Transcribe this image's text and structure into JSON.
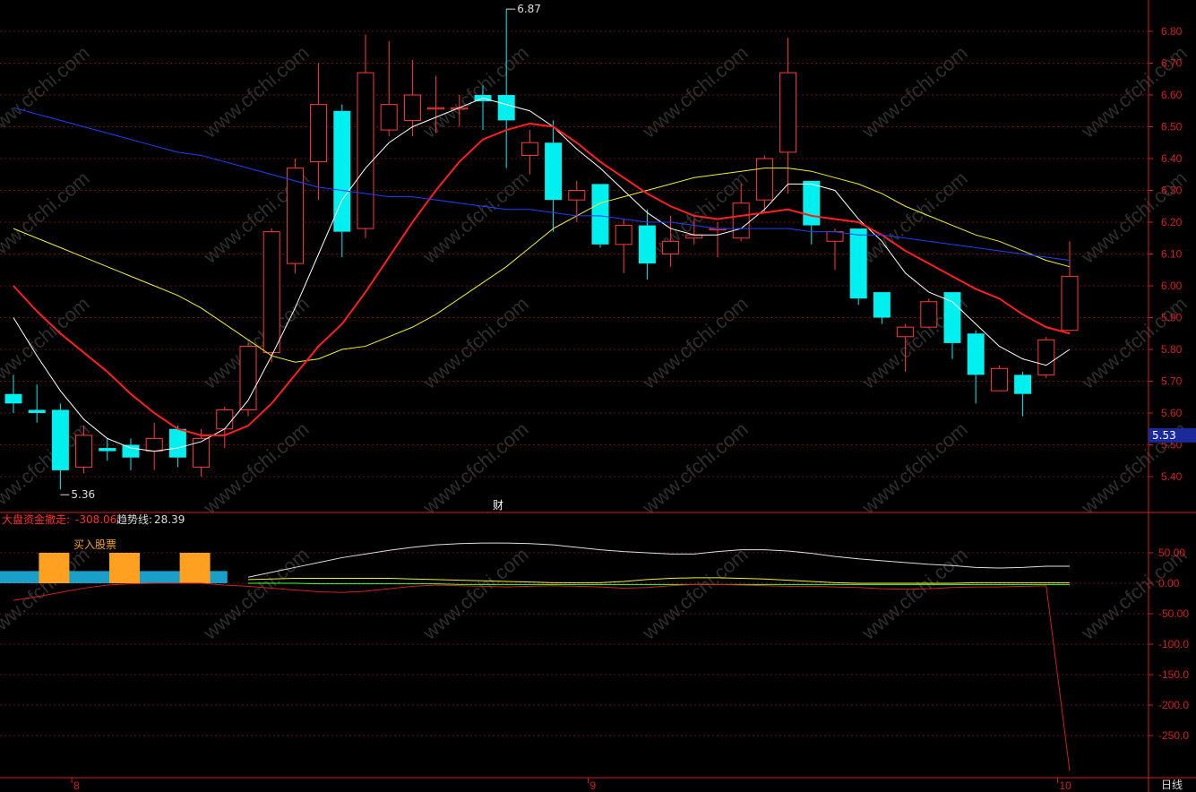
{
  "chart_data": [
    {
      "type": "candlestick",
      "panel": "price",
      "ylim": [
        5.35,
        6.9
      ],
      "yticks": [
        "6.80",
        "6.70",
        "6.60",
        "6.50",
        "6.40",
        "6.30",
        "6.20",
        "6.10",
        "6.00",
        "5.90",
        "5.80",
        "5.70",
        "5.60",
        "5.50",
        "5.40"
      ],
      "current_price_label": "5.53",
      "high_marker": "6.87",
      "low_marker": "5.36",
      "event_marker": "财",
      "candles": [
        {
          "o": 5.66,
          "c": 5.63,
          "h": 5.72,
          "l": 5.6
        },
        {
          "o": 5.61,
          "c": 5.6,
          "h": 5.69,
          "l": 5.57
        },
        {
          "o": 5.61,
          "c": 5.42,
          "h": 5.63,
          "l": 5.36
        },
        {
          "o": 5.43,
          "c": 5.53,
          "h": 5.56,
          "l": 5.41
        },
        {
          "o": 5.49,
          "c": 5.48,
          "h": 5.52,
          "l": 5.45
        },
        {
          "o": 5.5,
          "c": 5.46,
          "h": 5.52,
          "l": 5.42
        },
        {
          "o": 5.48,
          "c": 5.52,
          "h": 5.57,
          "l": 5.42
        },
        {
          "o": 5.55,
          "c": 5.46,
          "h": 5.56,
          "l": 5.43
        },
        {
          "o": 5.43,
          "c": 5.52,
          "h": 5.55,
          "l": 5.4
        },
        {
          "o": 5.55,
          "c": 5.61,
          "h": 5.62,
          "l": 5.49
        },
        {
          "o": 5.61,
          "c": 5.81,
          "h": 5.82,
          "l": 5.59
        },
        {
          "o": 5.79,
          "c": 6.17,
          "h": 6.18,
          "l": 5.76
        },
        {
          "o": 6.07,
          "c": 6.37,
          "h": 6.4,
          "l": 6.04
        },
        {
          "o": 6.39,
          "c": 6.57,
          "h": 6.7,
          "l": 6.27
        },
        {
          "o": 6.55,
          "c": 6.17,
          "h": 6.57,
          "l": 6.09
        },
        {
          "o": 6.18,
          "c": 6.67,
          "h": 6.79,
          "l": 6.15
        },
        {
          "o": 6.49,
          "c": 6.57,
          "h": 6.77,
          "l": 6.47
        },
        {
          "o": 6.52,
          "c": 6.6,
          "h": 6.71,
          "l": 6.47
        },
        {
          "o": 6.56,
          "c": 6.56,
          "h": 6.66,
          "l": 6.48
        },
        {
          "o": 6.56,
          "c": 6.56,
          "h": 6.6,
          "l": 6.5
        },
        {
          "o": 6.6,
          "c": 6.58,
          "h": 6.63,
          "l": 6.49
        },
        {
          "o": 6.6,
          "c": 6.52,
          "h": 6.87,
          "l": 6.37
        },
        {
          "o": 6.41,
          "c": 6.45,
          "h": 6.49,
          "l": 6.35
        },
        {
          "o": 6.45,
          "c": 6.27,
          "h": 6.52,
          "l": 6.17
        },
        {
          "o": 6.27,
          "c": 6.3,
          "h": 6.33,
          "l": 6.2
        },
        {
          "o": 6.32,
          "c": 6.13,
          "h": 6.32,
          "l": 6.12
        },
        {
          "o": 6.13,
          "c": 6.19,
          "h": 6.21,
          "l": 6.04
        },
        {
          "o": 6.19,
          "c": 6.07,
          "h": 6.24,
          "l": 6.02
        },
        {
          "o": 6.1,
          "c": 6.14,
          "h": 6.22,
          "l": 6.06
        },
        {
          "o": 6.15,
          "c": 6.16,
          "h": 6.21,
          "l": 6.13
        },
        {
          "o": 6.18,
          "c": 6.18,
          "h": 6.2,
          "l": 6.09
        },
        {
          "o": 6.15,
          "c": 6.26,
          "h": 6.32,
          "l": 6.14
        },
        {
          "o": 6.27,
          "c": 6.4,
          "h": 6.41,
          "l": 6.23
        },
        {
          "o": 6.42,
          "c": 6.67,
          "h": 6.78,
          "l": 6.29
        },
        {
          "o": 6.33,
          "c": 6.19,
          "h": 6.33,
          "l": 6.13
        },
        {
          "o": 6.14,
          "c": 6.17,
          "h": 6.18,
          "l": 6.05
        },
        {
          "o": 6.18,
          "c": 5.96,
          "h": 6.18,
          "l": 5.94
        },
        {
          "o": 5.98,
          "c": 5.9,
          "h": 5.98,
          "l": 5.88
        },
        {
          "o": 5.84,
          "c": 5.87,
          "h": 5.88,
          "l": 5.73
        },
        {
          "o": 5.87,
          "c": 5.95,
          "h": 5.96,
          "l": 5.87
        },
        {
          "o": 5.98,
          "c": 5.82,
          "h": 5.98,
          "l": 5.77
        },
        {
          "o": 5.85,
          "c": 5.72,
          "h": 5.86,
          "l": 5.63
        },
        {
          "o": 5.67,
          "c": 5.74,
          "h": 5.75,
          "l": 5.67
        },
        {
          "o": 5.72,
          "c": 5.66,
          "h": 5.73,
          "l": 5.59
        },
        {
          "o": 5.72,
          "c": 5.83,
          "h": 5.84,
          "l": 5.71
        },
        {
          "o": 5.86,
          "c": 6.03,
          "h": 6.14,
          "l": 5.86
        }
      ],
      "moving_averages": [
        {
          "color": "#ffffff",
          "values": [
            5.9,
            5.78,
            5.67,
            5.58,
            5.52,
            5.49,
            5.48,
            5.49,
            5.51,
            5.55,
            5.64,
            5.78,
            5.93,
            6.1,
            6.27,
            6.37,
            6.45,
            6.5,
            6.53,
            6.56,
            6.59,
            6.57,
            6.55,
            6.5,
            6.43,
            6.37,
            6.3,
            6.23,
            6.18,
            6.16,
            6.16,
            6.18,
            6.24,
            6.32,
            6.32,
            6.3,
            6.21,
            6.14,
            6.04,
            5.98,
            5.95,
            5.88,
            5.81,
            5.77,
            5.75,
            5.8
          ]
        },
        {
          "color": "#f0f030",
          "values": [
            6.18,
            6.15,
            6.12,
            6.09,
            6.06,
            6.03,
            6.0,
            5.97,
            5.93,
            5.88,
            5.83,
            5.78,
            5.76,
            5.77,
            5.8,
            5.81,
            5.84,
            5.87,
            5.91,
            5.96,
            6.01,
            6.06,
            6.12,
            6.18,
            6.22,
            6.26,
            6.28,
            6.3,
            6.32,
            6.34,
            6.35,
            6.36,
            6.37,
            6.37,
            6.36,
            6.34,
            6.32,
            6.29,
            6.25,
            6.22,
            6.19,
            6.16,
            6.14,
            6.11,
            6.08,
            6.06
          ]
        },
        {
          "color": "#ff2020",
          "values": [
            6.0,
            5.92,
            5.85,
            5.79,
            5.73,
            5.66,
            5.6,
            5.55,
            5.53,
            5.53,
            5.56,
            5.63,
            5.72,
            5.81,
            5.88,
            5.98,
            6.09,
            6.2,
            6.3,
            6.39,
            6.46,
            6.49,
            6.51,
            6.5,
            6.45,
            6.39,
            6.34,
            6.29,
            6.25,
            6.22,
            6.21,
            6.22,
            6.23,
            6.24,
            6.22,
            6.21,
            6.2,
            6.16,
            6.11,
            6.07,
            6.03,
            5.99,
            5.96,
            5.91,
            5.87,
            5.85
          ]
        },
        {
          "color": "#2040ff",
          "values": [
            6.56,
            6.54,
            6.52,
            6.5,
            6.48,
            6.46,
            6.44,
            6.42,
            6.41,
            6.39,
            6.37,
            6.35,
            6.33,
            6.31,
            6.3,
            6.29,
            6.28,
            6.28,
            6.27,
            6.26,
            6.25,
            6.24,
            6.24,
            6.23,
            6.22,
            6.22,
            6.21,
            6.2,
            6.2,
            6.19,
            6.18,
            6.18,
            6.18,
            6.18,
            6.17,
            6.17,
            6.16,
            6.16,
            6.15,
            6.14,
            6.13,
            6.12,
            6.11,
            6.1,
            6.09,
            6.08
          ]
        }
      ]
    },
    {
      "type": "line",
      "panel": "indicator",
      "ylim": [
        -310,
        100
      ],
      "yticks": [
        "50.00",
        "0.00",
        "-50.00",
        "-100.0",
        "-150.0",
        "-200.0",
        "-250.0"
      ],
      "legend": [
        {
          "label": "大盘资金撤走:",
          "value": "-308.06",
          "color": "#ff3030"
        },
        {
          "label": "趋势线:",
          "value": "28.39",
          "color": "#dddddd"
        }
      ],
      "buy_label": "买入股票",
      "buy_bars": [
        2,
        5,
        8
      ],
      "blue_band": [
        0,
        9
      ],
      "series": [
        {
          "color": "#dddddd",
          "values": [
            null,
            null,
            null,
            null,
            null,
            null,
            null,
            null,
            null,
            null,
            10,
            18,
            26,
            34,
            42,
            48,
            54,
            59,
            63,
            65,
            66,
            66,
            65,
            63,
            59,
            55,
            52,
            50,
            48,
            48,
            52,
            55,
            55,
            53,
            49,
            44,
            40,
            37,
            34,
            31,
            29,
            26,
            25,
            26,
            28,
            28
          ]
        },
        {
          "color": "#f0f030",
          "values": [
            null,
            null,
            null,
            null,
            null,
            null,
            null,
            null,
            null,
            null,
            6,
            7,
            8,
            8,
            8,
            8,
            8,
            7,
            6,
            5,
            4,
            3,
            2,
            1,
            1,
            1,
            3,
            6,
            8,
            9,
            9,
            8,
            7,
            5,
            3,
            1,
            0,
            0,
            0,
            0,
            0,
            1,
            1,
            1,
            1,
            1
          ]
        },
        {
          "color": "#40ff40",
          "values": [
            null,
            null,
            null,
            null,
            null,
            null,
            null,
            null,
            null,
            null,
            0,
            0,
            0,
            -1,
            -1,
            -1,
            -1,
            -1,
            -1,
            -2,
            -2,
            -2,
            -2,
            -2,
            -2,
            -2,
            -2,
            -2,
            -2,
            -2,
            -2,
            -2,
            -2,
            -2,
            -2,
            -2,
            -2,
            -2,
            -2,
            -2,
            -2,
            -2,
            -2,
            -2,
            -2,
            -2
          ]
        },
        {
          "color": "#d02020",
          "values": [
            -28,
            -22,
            -15,
            -8,
            -3,
            -1,
            0,
            0,
            0,
            -3,
            -5,
            -8,
            -11,
            -14,
            -15,
            -13,
            -9,
            -5,
            -3,
            -4,
            -5,
            -6,
            -5,
            -4,
            -5,
            -6,
            -8,
            -7,
            -4,
            -2,
            -2,
            -3,
            -4,
            -5,
            -5,
            -6,
            -7,
            -9,
            -10,
            -9,
            -7,
            -6,
            -6,
            -5,
            -4,
            -308.06
          ]
        }
      ]
    }
  ],
  "x_axis": {
    "labels": [
      {
        "text": "8",
        "index": 3
      },
      {
        "text": "9",
        "index": 25
      },
      {
        "text": "10",
        "index": 45
      }
    ]
  },
  "period_label": "日线",
  "watermark": "www.cfchi.com"
}
